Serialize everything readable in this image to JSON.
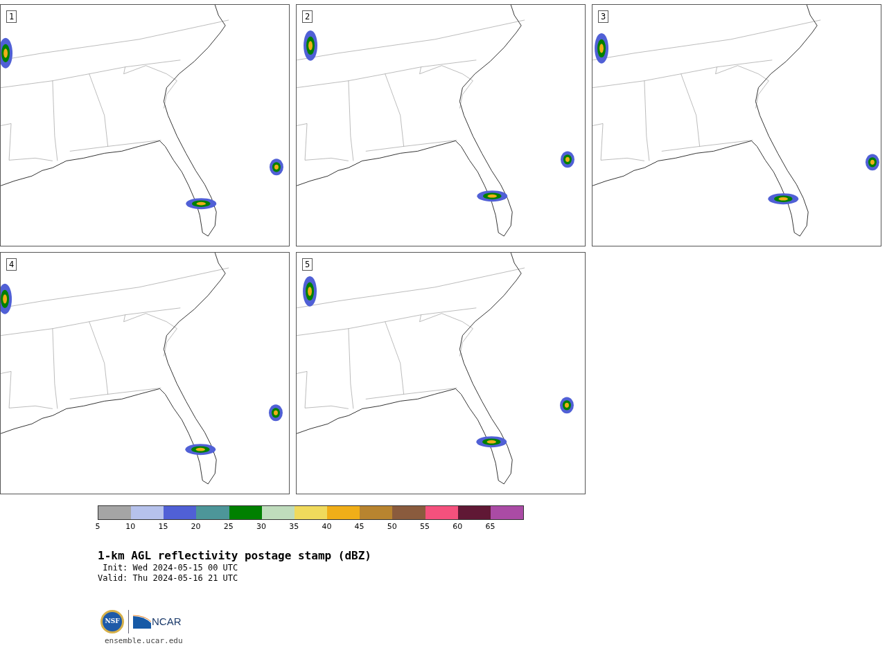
{
  "panels": [
    {
      "label": "1"
    },
    {
      "label": "2"
    },
    {
      "label": "3"
    },
    {
      "label": "4"
    },
    {
      "label": "5"
    }
  ],
  "colorbar": {
    "bins": [
      {
        "color": "#a5a5a5"
      },
      {
        "color": "#b6c2ec"
      },
      {
        "color": "#5060d6"
      },
      {
        "color": "#4d9699"
      },
      {
        "color": "#008000"
      },
      {
        "color": "#bfdcbc"
      },
      {
        "color": "#f0da5c"
      },
      {
        "color": "#f0ae18"
      },
      {
        "color": "#b8842f"
      },
      {
        "color": "#8a5b3d"
      },
      {
        "color": "#f4517d"
      },
      {
        "color": "#601835"
      },
      {
        "color": "#aa4ba5"
      }
    ],
    "ticks": [
      "5",
      "10",
      "15",
      "20",
      "25",
      "30",
      "35",
      "40",
      "45",
      "50",
      "55",
      "60",
      "65"
    ]
  },
  "title": "1-km AGL reflectivity postage stamp (dBZ)",
  "init": " Init: Wed 2024-05-15 00 UTC",
  "valid": "Valid: Thu 2024-05-16 21 UTC",
  "logos": {
    "nsf": "NSF",
    "ncar": "NCAR"
  },
  "url": "ensemble.ucar.edu"
}
